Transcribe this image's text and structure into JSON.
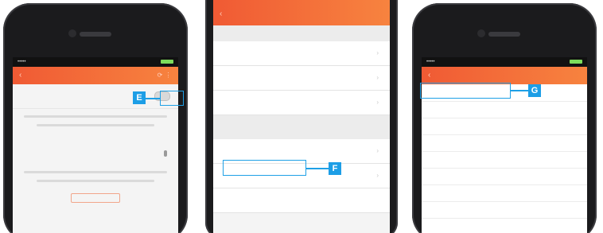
{
  "callouts": {
    "e": "E",
    "f": "F",
    "g": "G"
  },
  "colors": {
    "accent": "#f2683a",
    "callout": "#1ea0e6"
  },
  "icons": {
    "back": "chevron-left-icon",
    "list_chevron": "chevron-right-icon",
    "microphone": "microphone-icon",
    "battery": "battery-icon"
  }
}
